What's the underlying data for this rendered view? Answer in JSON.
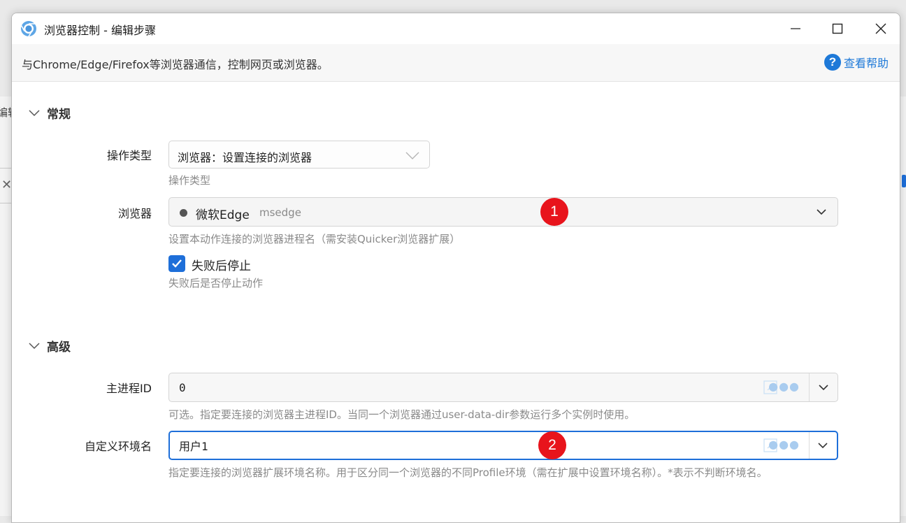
{
  "background": {
    "left_text": "编辑"
  },
  "window": {
    "title": "浏览器控制  -  编辑步骤",
    "description": "与Chrome/Edge/Firefox等浏览器通信，控制网页或浏览器。",
    "help_label": "查看帮助",
    "help_icon": "question-circle-icon"
  },
  "sections": {
    "general_title": "常规",
    "advanced_title": "高级"
  },
  "fields": {
    "operation_type": {
      "label": "操作类型",
      "value": "浏览器：设置连接的浏览器",
      "hint": "操作类型"
    },
    "browser": {
      "label": "浏览器",
      "name": "微软Edge",
      "id": "msedge",
      "hint": "设置本动作连接的浏览器进程名（需安装Quicker浏览器扩展）"
    },
    "stop_on_fail": {
      "label": "失败后停止",
      "checked": true,
      "hint": "失败后是否停止动作"
    },
    "main_pid": {
      "label": "主进程ID",
      "value": "0",
      "hint": "可选。指定要连接的浏览器主进程ID。当同一个浏览器通过user-data-dir参数运行多个实例时使用。"
    },
    "env_name": {
      "label": "自定义环境名",
      "value": "用户1",
      "hint": "指定要连接的浏览器扩展环境名称。用于区分同一个浏览器的不同Profile环境（需在扩展中设置环境名称）。*表示不判断环境名。"
    }
  },
  "annotations": {
    "badge1": "1",
    "badge2": "2",
    "color": "#e8141c"
  },
  "colors": {
    "accent": "#1e6fd9",
    "link": "#1e79d8",
    "hint": "#8a8a8a"
  }
}
